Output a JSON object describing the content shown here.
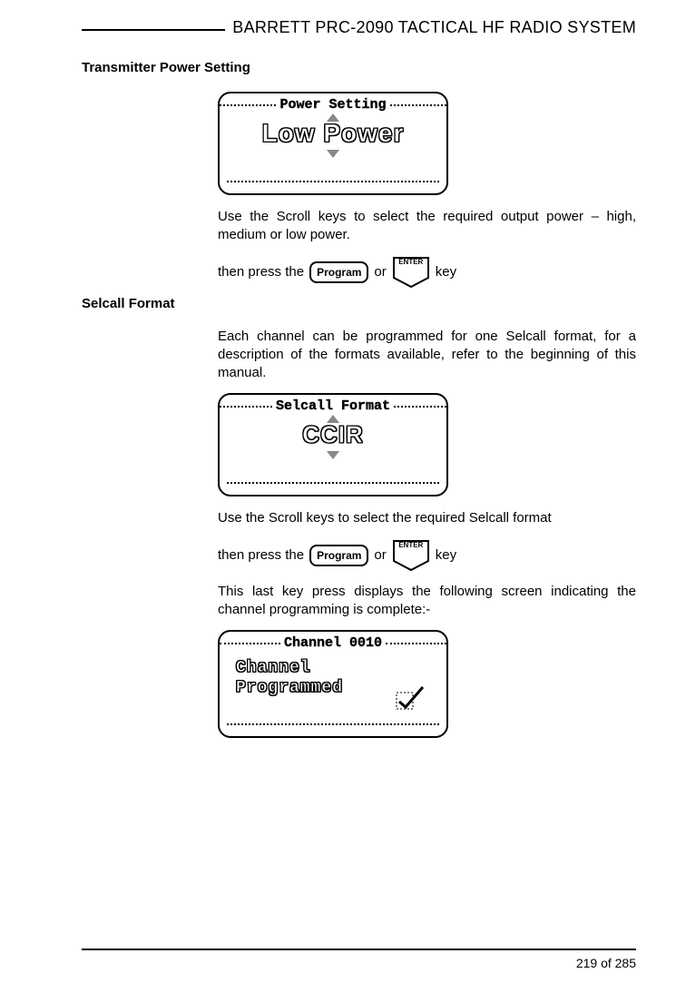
{
  "header": {
    "title": "BARRETT PRC-2090 TACTICAL HF RADIO SYSTEM"
  },
  "section1": {
    "title": "Transmitter Power Setting",
    "display": {
      "label": "Power Setting",
      "value": "Low Power"
    },
    "p1": "Use the Scroll keys to select the required output power – high, medium or low power.",
    "press_prefix": "then press the",
    "or": "or",
    "press_suffix": "key"
  },
  "buttons": {
    "program": "Program",
    "enter": "ENTER"
  },
  "section2": {
    "title": "Selcall Format",
    "p1": "Each channel can be programmed for one Selcall format, for a description of the formats available, refer to the beginning of this manual.",
    "display": {
      "label": "Selcall Format",
      "value": "CCIR"
    },
    "p2": "Use the Scroll keys to select the required Selcall format",
    "press_prefix": "then press the",
    "or": "or",
    "press_suffix": "key",
    "p3": "This last key press displays the following screen indicating the channel programming is complete:-",
    "display2": {
      "label": "Channel 0010",
      "line1": "Channel",
      "line2": "Programmed"
    }
  },
  "footer": {
    "page": "219 of 285"
  }
}
